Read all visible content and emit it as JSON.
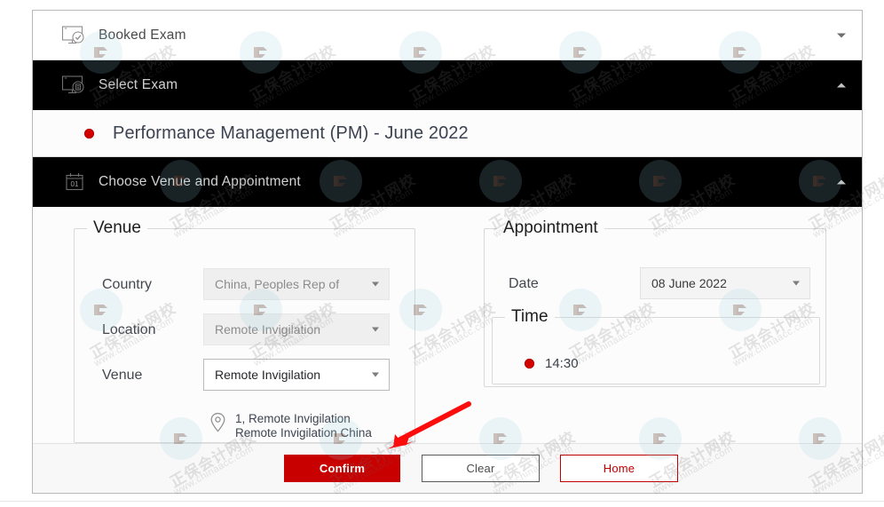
{
  "accordions": [
    {
      "id": "booked-exam",
      "title": "Booked Exam",
      "icon": "monitor-check-icon",
      "state": "collapsed",
      "chevron": "chevron-down-icon"
    },
    {
      "id": "select-exam",
      "title": "Select Exam",
      "icon": "monitor-document-icon",
      "state": "expanded",
      "chevron": "chevron-up-icon"
    },
    {
      "id": "choose-venue",
      "title": "Choose Venue and Appointment",
      "icon": "calendar-01-icon",
      "icon_text": "01",
      "state": "expanded",
      "chevron": "chevron-up-icon"
    }
  ],
  "exam_option": {
    "label": "Performance Management (PM) - June 2022",
    "selected": true,
    "radio_color": "#d40000"
  },
  "venue": {
    "legend": "Venue",
    "fields": [
      {
        "label": "Country",
        "value": "China, Peoples Rep of",
        "disabled": true
      },
      {
        "label": "Location",
        "value": "Remote Invigilation",
        "disabled": true
      },
      {
        "label": "Venue",
        "value": "Remote Invigilation",
        "disabled": false
      }
    ],
    "address": {
      "icon": "map-pin-icon",
      "line1": "1, Remote Invigilation",
      "line2": "Remote Invigilation China"
    }
  },
  "appointment": {
    "legend": "Appointment",
    "date": {
      "label": "Date",
      "value": "08 June 2022"
    },
    "time": {
      "legend": "Time",
      "options": [
        {
          "label": "14:30",
          "selected": true
        }
      ]
    }
  },
  "footer": {
    "confirm_label": "Confirm",
    "clear_label": "Clear",
    "home_label": "Home"
  },
  "colors": {
    "brand_red": "#c80000",
    "radio_red": "#d40000",
    "header_black": "#000000",
    "annotation_red": "#fb0d0d"
  },
  "watermark": {
    "cn": "正保会计网校",
    "en": "www.chinaacc.com"
  }
}
